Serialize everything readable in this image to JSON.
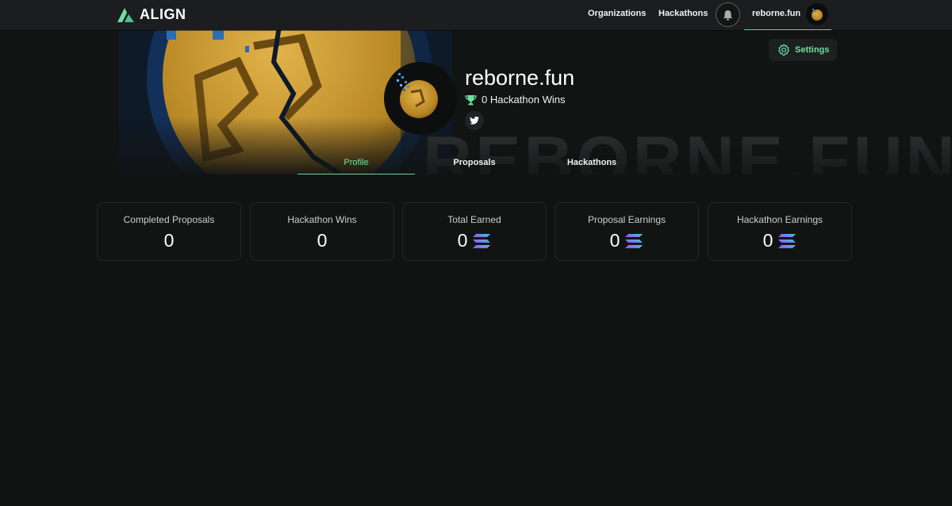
{
  "nav": {
    "brand": "ALIGN",
    "links": [
      "Organizations",
      "Hackathons"
    ],
    "user": "reborne.fun",
    "accent": "#6fcf9f"
  },
  "banner": {
    "watermark": "REBORNE.FUN"
  },
  "profile": {
    "name": "reborne.fun",
    "wins": "0 Hackathon Wins",
    "settings": "Settings"
  },
  "tabs": [
    "Profile",
    "Proposals",
    "Hackathons"
  ],
  "stats": [
    {
      "label": "Completed Proposals",
      "value": "0",
      "token": false
    },
    {
      "label": "Hackathon Wins",
      "value": "0",
      "token": false
    },
    {
      "label": "Total Earned",
      "value": "0",
      "token": true
    },
    {
      "label": "Proposal Earnings",
      "value": "0",
      "token": true
    },
    {
      "label": "Hackathon Earnings",
      "value": "0",
      "token": true
    }
  ],
  "icons": [
    "align-logo-icon",
    "bell-icon",
    "gear-icon",
    "trophy-icon",
    "twitter-icon",
    "solana-icon"
  ]
}
